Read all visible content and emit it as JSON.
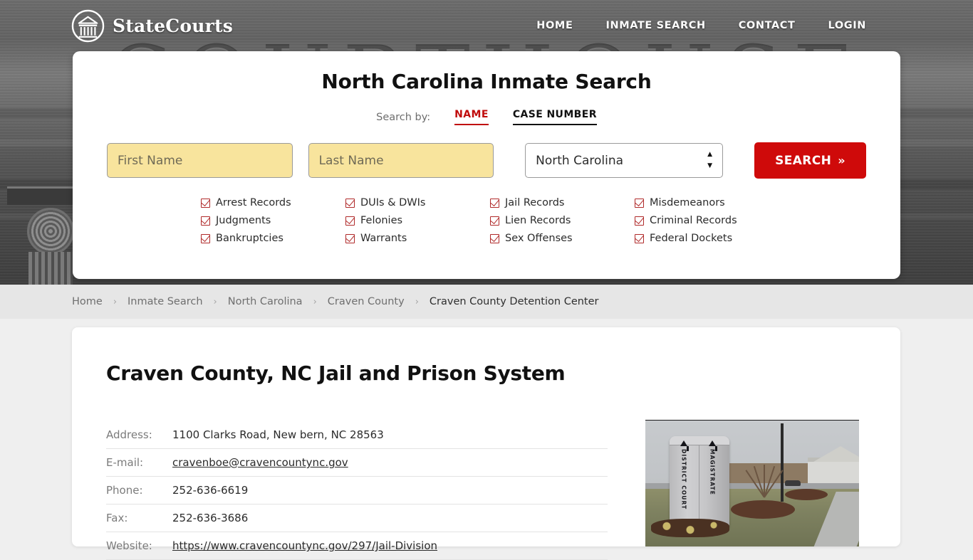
{
  "header": {
    "brand_name": "StateCourts",
    "brand_icon": "courthouse-circle-logo",
    "nav": [
      {
        "label": "HOME"
      },
      {
        "label": "INMATE SEARCH"
      },
      {
        "label": "CONTACT"
      },
      {
        "label": "LOGIN"
      }
    ]
  },
  "search_card": {
    "title": "North Carolina Inmate Search",
    "search_by_label": "Search by:",
    "tabs": [
      {
        "label": "NAME",
        "active": true
      },
      {
        "label": "CASE NUMBER",
        "active": false
      }
    ],
    "first_name_placeholder": "First Name",
    "first_name_value": "",
    "last_name_placeholder": "Last Name",
    "last_name_value": "",
    "state_value": "North Carolina",
    "search_button": "SEARCH",
    "search_button_chevron": "»",
    "checkboxes": [
      "Arrest Records",
      "DUIs & DWIs",
      "Jail Records",
      "Misdemeanors",
      "Judgments",
      "Felonies",
      "Lien Records",
      "Criminal Records",
      "Bankruptcies",
      "Warrants",
      "Sex Offenses",
      "Federal Dockets"
    ]
  },
  "breadcrumb": {
    "separator": "›",
    "items": [
      {
        "label": "Home",
        "current": false
      },
      {
        "label": "Inmate Search",
        "current": false
      },
      {
        "label": "North Carolina",
        "current": false
      },
      {
        "label": "Craven County",
        "current": false
      },
      {
        "label": "Craven County Detention Center",
        "current": true
      }
    ]
  },
  "content": {
    "page_title": "Craven County, NC Jail and Prison System",
    "details": [
      {
        "key": "Address:",
        "value": "1100 Clarks Road, New bern, NC 28563",
        "link": false
      },
      {
        "key": "E-mail:",
        "value": "cravenboe@cravencountync.gov",
        "link": true
      },
      {
        "key": "Phone:",
        "value": "252-636-6619",
        "link": false
      },
      {
        "key": "Fax:",
        "value": "252-636-3686",
        "link": false
      },
      {
        "key": "Website:",
        "value": "https://www.cravencountync.gov/297/Jail-Division",
        "link": true
      }
    ],
    "photo": {
      "name": "craven-county-courthouse-photo",
      "sign_left": "DISTRICT COURT",
      "sign_right": "MAGISTRATE"
    }
  },
  "hero": {
    "background_word": "COURTHOUSE"
  },
  "colors": {
    "accent_red": "#cf0a0a",
    "tab_active_red": "#c00b0b",
    "field_yellow": "#f8e49d",
    "page_bg": "#efefef",
    "breadcrumb_bg": "#e6e6e6"
  }
}
